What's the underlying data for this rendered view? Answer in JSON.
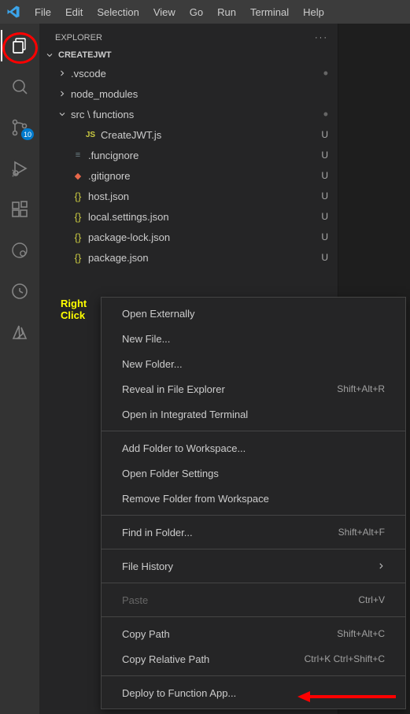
{
  "menubar": [
    "File",
    "Edit",
    "Selection",
    "View",
    "Go",
    "Run",
    "Terminal",
    "Help"
  ],
  "activity": {
    "scm_badge": "10"
  },
  "sidebar": {
    "title": "EXPLORER",
    "root": "CREATEJWT",
    "tree": [
      {
        "indent": 1,
        "chev": "right",
        "icon": "",
        "label": ".vscode",
        "status": "dot"
      },
      {
        "indent": 1,
        "chev": "right",
        "icon": "",
        "label": "node_modules",
        "status": ""
      },
      {
        "indent": 1,
        "chev": "down",
        "icon": "",
        "label": "src \\ functions",
        "status": "dot"
      },
      {
        "indent": 2,
        "chev": "",
        "icon": "JS",
        "iconClass": "js",
        "label": "CreateJWT.js",
        "status": "U"
      },
      {
        "indent": 1,
        "chev": "",
        "icon": "≡",
        "iconClass": "misc",
        "label": ".funcignore",
        "status": "U"
      },
      {
        "indent": 1,
        "chev": "",
        "icon": "◆",
        "iconClass": "git",
        "label": ".gitignore",
        "status": "U"
      },
      {
        "indent": 1,
        "chev": "",
        "icon": "{}",
        "iconClass": "json",
        "label": "host.json",
        "status": "U"
      },
      {
        "indent": 1,
        "chev": "",
        "icon": "{}",
        "iconClass": "json",
        "label": "local.settings.json",
        "status": "U"
      },
      {
        "indent": 1,
        "chev": "",
        "icon": "{}",
        "iconClass": "json",
        "label": "package-lock.json",
        "status": "U"
      },
      {
        "indent": 1,
        "chev": "",
        "icon": "{}",
        "iconClass": "json",
        "label": "package.json",
        "status": "U"
      }
    ]
  },
  "annotation": {
    "line1": "Right",
    "line2": "Click"
  },
  "context_menu": [
    {
      "type": "item",
      "label": "Open Externally",
      "shortcut": ""
    },
    {
      "type": "item",
      "label": "New File...",
      "shortcut": ""
    },
    {
      "type": "item",
      "label": "New Folder...",
      "shortcut": ""
    },
    {
      "type": "item",
      "label": "Reveal in File Explorer",
      "shortcut": "Shift+Alt+R"
    },
    {
      "type": "item",
      "label": "Open in Integrated Terminal",
      "shortcut": ""
    },
    {
      "type": "sep"
    },
    {
      "type": "item",
      "label": "Add Folder to Workspace...",
      "shortcut": ""
    },
    {
      "type": "item",
      "label": "Open Folder Settings",
      "shortcut": ""
    },
    {
      "type": "item",
      "label": "Remove Folder from Workspace",
      "shortcut": ""
    },
    {
      "type": "sep"
    },
    {
      "type": "item",
      "label": "Find in Folder...",
      "shortcut": "Shift+Alt+F"
    },
    {
      "type": "sep"
    },
    {
      "type": "item",
      "label": "File History",
      "shortcut": "",
      "submenu": true
    },
    {
      "type": "sep"
    },
    {
      "type": "item",
      "label": "Paste",
      "shortcut": "Ctrl+V",
      "disabled": true
    },
    {
      "type": "sep"
    },
    {
      "type": "item",
      "label": "Copy Path",
      "shortcut": "Shift+Alt+C"
    },
    {
      "type": "item",
      "label": "Copy Relative Path",
      "shortcut": "Ctrl+K Ctrl+Shift+C"
    },
    {
      "type": "sep"
    },
    {
      "type": "item",
      "label": "Deploy to Function App...",
      "shortcut": ""
    }
  ]
}
